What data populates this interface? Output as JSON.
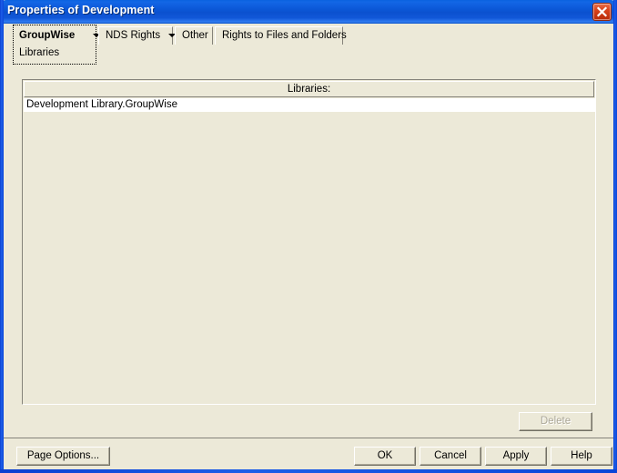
{
  "window": {
    "title": "Properties of Development",
    "close_icon": "close-icon",
    "accent_color": "#0b57d6",
    "face_color": "#ece9d8"
  },
  "tabs": [
    {
      "label": "GroupWise",
      "sub_label": "Libraries",
      "has_dropdown": true,
      "selected": true
    },
    {
      "label": "NDS Rights",
      "has_dropdown": true,
      "selected": false
    },
    {
      "label": "Other",
      "has_dropdown": false,
      "selected": false
    },
    {
      "label": "Rights to Files and Folders",
      "has_dropdown": false,
      "selected": false
    }
  ],
  "list": {
    "header": "Libraries:",
    "rows": [
      "Development Library.GroupWise"
    ]
  },
  "actions": {
    "delete_label": "Delete",
    "delete_disabled": true
  },
  "footer": {
    "page_options_label": "Page Options...",
    "ok_label": "OK",
    "cancel_label": "Cancel",
    "apply_label": "Apply",
    "help_label": "Help"
  }
}
